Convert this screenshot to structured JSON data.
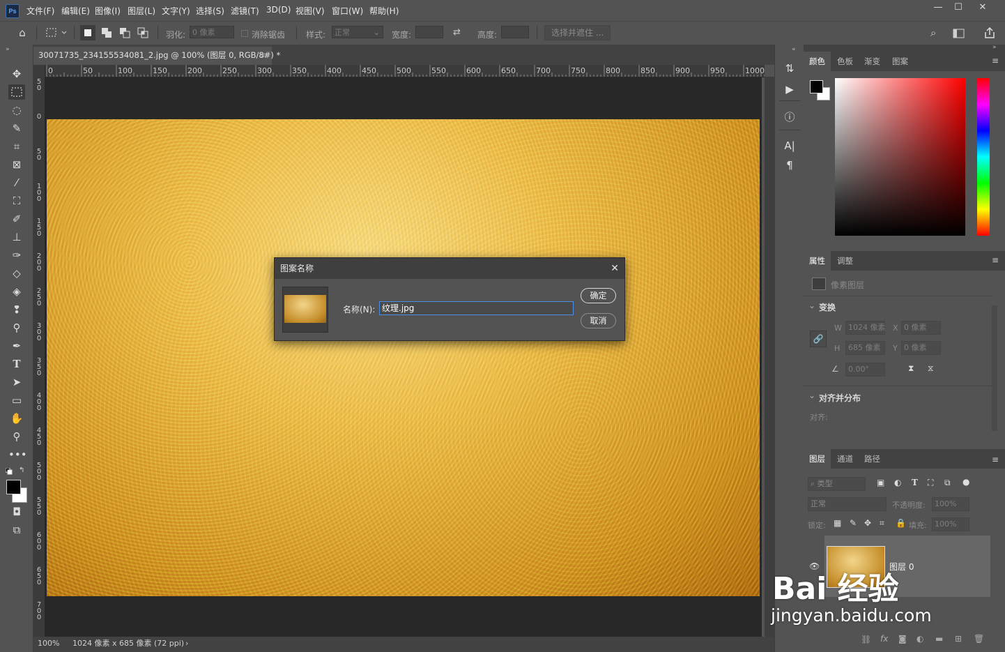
{
  "menubar": {
    "logo": "Ps",
    "items": [
      "文件(F)",
      "编辑(E)",
      "图像(I)",
      "图层(L)",
      "文字(Y)",
      "选择(S)",
      "滤镜(T)",
      "3D(D)",
      "视图(V)",
      "窗口(W)",
      "帮助(H)"
    ],
    "window_minimize": "—",
    "window_restore": "☐",
    "window_close": "✕"
  },
  "options": {
    "feather_label": "羽化:",
    "feather_value": "0 像素",
    "antialias_label": "消除锯齿",
    "style_label": "样式:",
    "style_value": "正常",
    "width_label": "宽度:",
    "height_label": "高度:",
    "select_mask_label": "选择并遮住 ..."
  },
  "document": {
    "tab_title": "30071735_234155534081_2.jpg @ 100% (图层 0, RGB/8#) *",
    "tab_close": "×",
    "ruler_top": [
      "0",
      "50",
      "100",
      "150",
      "200",
      "250",
      "300",
      "350",
      "400",
      "450",
      "500",
      "550",
      "600",
      "650",
      "700",
      "750",
      "800",
      "850",
      "900",
      "950",
      "1000"
    ],
    "ruler_left": [
      "50",
      "0",
      "50",
      "100",
      "150",
      "200",
      "250",
      "300",
      "350",
      "400",
      "450",
      "500",
      "550",
      "600",
      "650",
      "700"
    ],
    "zoom": "100%",
    "info": "1024 像素 x 685 像素 (72 ppi)",
    "status_arrow": "›"
  },
  "dialog": {
    "title": "图案名称",
    "close": "✕",
    "name_label": "名称(N):",
    "name_value": "纹理.jpg",
    "ok_label": "确定",
    "cancel_label": "取消"
  },
  "color_panel": {
    "tabs": [
      "颜色",
      "色板",
      "渐变",
      "图案"
    ],
    "foreground": "#000000",
    "background": "#ffffff",
    "hue": "#ff0000"
  },
  "properties_panel": {
    "tabs": [
      "属性",
      "调整"
    ],
    "layer_type": "像素图层",
    "transform_title": "变换",
    "w_label": "W",
    "w_value": "1024 像素",
    "h_label": "H",
    "h_value": "685 像素",
    "x_label": "X",
    "x_value": "0 像素",
    "y_label": "Y",
    "y_value": "0 像素",
    "angle_value": "0.00°",
    "align_title": "对齐并分布",
    "align_label": "对齐:"
  },
  "layers_panel": {
    "tabs": [
      "图层",
      "通道",
      "路径"
    ],
    "filter_label": "类型",
    "blend_mode": "正常",
    "opacity_label": "不透明度:",
    "opacity_value": "100%",
    "lock_label": "锁定:",
    "fill_label": "填充:",
    "fill_value": "100%",
    "layer_name": "图层 0"
  },
  "watermark": {
    "brand": "Bai 经验",
    "url": "jingyan.baidu.com"
  }
}
